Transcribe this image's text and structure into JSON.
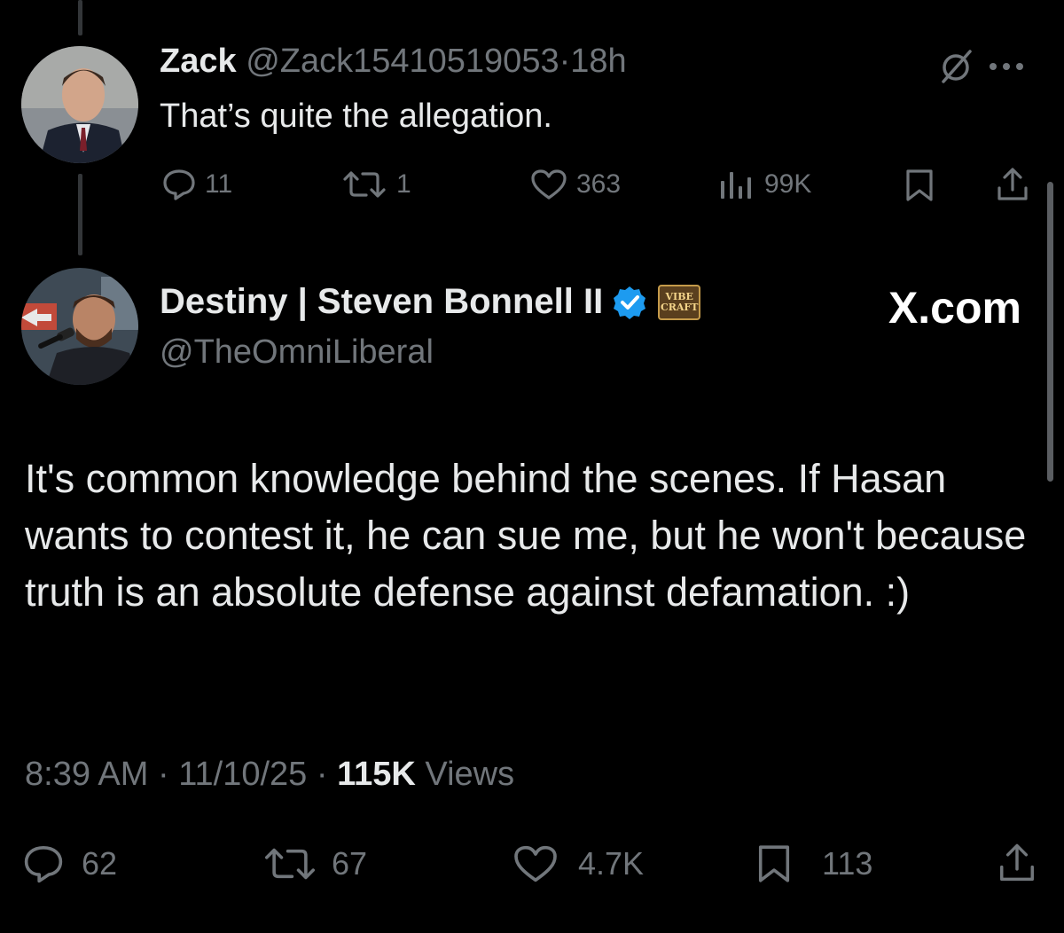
{
  "reply": {
    "name": "Zack",
    "handle": "@Zack15410519053",
    "separator": "·",
    "age": "18h",
    "text": "That’s quite the allegation.",
    "replies": "11",
    "reposts": "1",
    "likes": "363",
    "views": "99K"
  },
  "main": {
    "name": "Destiny | Steven Bonnell II",
    "badge_text_1": "VIBE",
    "badge_text_2": "CRAFT",
    "handle": "@TheOmniLiberal",
    "site": "X.com",
    "text": "It's common knowledge behind the scenes. If Hasan wants to contest it, he can sue me, but he won't because truth is an absolute defense against defamation. :)",
    "time": "8:39 AM",
    "separator": "·",
    "date": "11/10/25",
    "views_count": "115K",
    "views_label": "Views",
    "replies": "62",
    "reposts": "67",
    "likes": "4.7K",
    "bookmarks": "113"
  },
  "colors": {
    "background": "#000000",
    "text": "#e7e9ea",
    "muted": "#71767b",
    "verified": "#1d9bf0"
  }
}
